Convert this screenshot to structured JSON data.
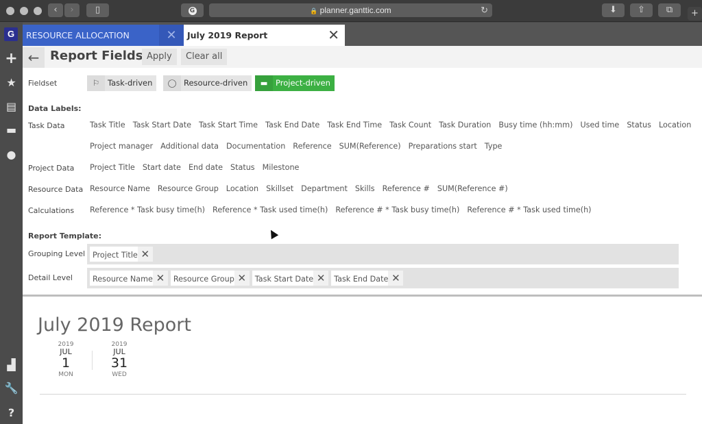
{
  "browser": {
    "url": "planner.ganttic.com",
    "nav_back": "‹",
    "nav_forward": "›"
  },
  "tabs": [
    {
      "label": "RESOURCE ALLOCATION",
      "close": "✕"
    },
    {
      "label": "July 2019 Report",
      "close": "✕"
    }
  ],
  "rail": {
    "logo": "G",
    "icons": [
      "plus-icon",
      "star-icon",
      "report-icon",
      "project-icon",
      "resource-drop-icon",
      "org-icon",
      "wrench-icon",
      "help-icon"
    ]
  },
  "header": {
    "back": "←",
    "title": "Report Fields",
    "apply": "Apply",
    "clear_all": "Clear all"
  },
  "fieldset": {
    "label": "Fieldset",
    "options": [
      {
        "label": "Task-driven",
        "icon": "flag-icon",
        "selected": false
      },
      {
        "label": "Resource-driven",
        "icon": "drop-icon",
        "selected": false
      },
      {
        "label": "Project-driven",
        "icon": "folder-icon",
        "selected": true
      }
    ],
    "accent": "#3cb043"
  },
  "data_labels": {
    "heading": "Data Labels:",
    "groups": [
      {
        "label": "Task Data",
        "rows": [
          [
            "Task Title",
            "Task Start Date",
            "Task Start Time",
            "Task End Date",
            "Task End Time",
            "Task Count",
            "Task Duration",
            "Busy time (hh:mm)",
            "Used time",
            "Status",
            "Location"
          ],
          [
            "Project manager",
            "Additional data",
            "Documentation",
            "Reference",
            "SUM(Reference)",
            "Preparations start",
            "Type"
          ]
        ]
      },
      {
        "label": "Project Data",
        "rows": [
          [
            "Project Title",
            "Start date",
            "End date",
            "Status",
            "Milestone"
          ]
        ]
      },
      {
        "label": "Resource Data",
        "rows": [
          [
            "Resource Name",
            "Resource Group",
            "Location",
            "Skillset",
            "Department",
            "Skills",
            "Reference #",
            "SUM(Reference #)"
          ]
        ]
      },
      {
        "label": "Calculations",
        "rows": [
          [
            "Reference * Task busy time(h)",
            "Reference * Task used time(h)",
            "Reference # * Task busy time(h)",
            "Reference # * Task used time(h)"
          ]
        ]
      }
    ]
  },
  "report_template": {
    "heading": "Report Template:",
    "grouping": {
      "label": "Grouping Level",
      "chips": [
        "Project Title"
      ]
    },
    "detail": {
      "label": "Detail Level",
      "chips": [
        "Resource Name",
        "Resource Group",
        "Task Start Date",
        "Task End Date"
      ]
    },
    "remove_glyph": "✕"
  },
  "report": {
    "title": "July 2019 Report",
    "start": {
      "year": "2019",
      "month": "JUL",
      "day": "1",
      "weekday": "MON"
    },
    "end": {
      "year": "2019",
      "month": "JUL",
      "day": "31",
      "weekday": "WED"
    }
  }
}
